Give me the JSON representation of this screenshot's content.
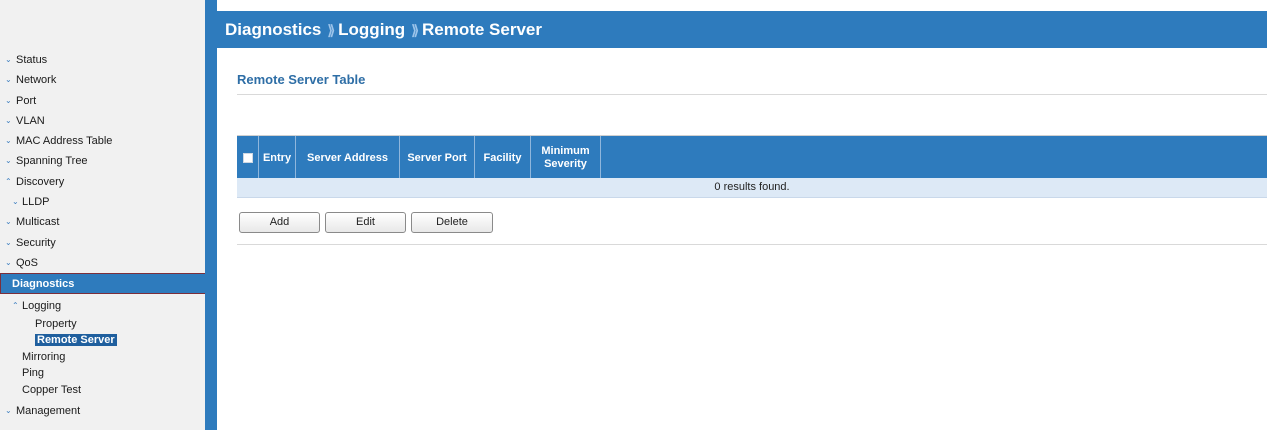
{
  "breadcrumb": {
    "items": [
      "Diagnostics",
      "Logging",
      "Remote Server"
    ],
    "separator": "⟫"
  },
  "sidebar": {
    "items": [
      {
        "label": "Status",
        "arrow": "⌄"
      },
      {
        "label": "Network",
        "arrow": "⌄"
      },
      {
        "label": "Port",
        "arrow": "⌄"
      },
      {
        "label": "VLAN",
        "arrow": "⌄"
      },
      {
        "label": "MAC Address Table",
        "arrow": "⌄"
      },
      {
        "label": "Spanning Tree",
        "arrow": "⌄"
      },
      {
        "label": "Discovery",
        "arrow": "⌃"
      },
      {
        "label": "LLDP",
        "arrow": "⌄"
      },
      {
        "label": "Multicast",
        "arrow": "⌄"
      },
      {
        "label": "Security",
        "arrow": "⌄"
      },
      {
        "label": "QoS",
        "arrow": "⌄"
      },
      {
        "label": "Diagnostics"
      },
      {
        "label": "Logging",
        "arrow": "⌃"
      },
      {
        "label": "Property"
      },
      {
        "label": "Remote Server"
      },
      {
        "label": "Mirroring"
      },
      {
        "label": "Ping"
      },
      {
        "label": "Copper Test"
      },
      {
        "label": "Management",
        "arrow": "⌄"
      }
    ]
  },
  "main": {
    "section_title": "Remote Server Table",
    "search": {
      "value": "",
      "icon": "search-icon"
    },
    "table": {
      "columns": [
        "Entry",
        "Server Address",
        "Server Port",
        "Facility",
        "Minimum Severity"
      ],
      "empty_message": "0 results found."
    },
    "buttons": {
      "add": "Add",
      "edit": "Edit",
      "delete": "Delete"
    }
  },
  "colors": {
    "accent": "#2e7bbd",
    "sidebar_bg": "#f1f1f1",
    "row_bg": "#dde9f6",
    "title": "#2e6ea6"
  }
}
